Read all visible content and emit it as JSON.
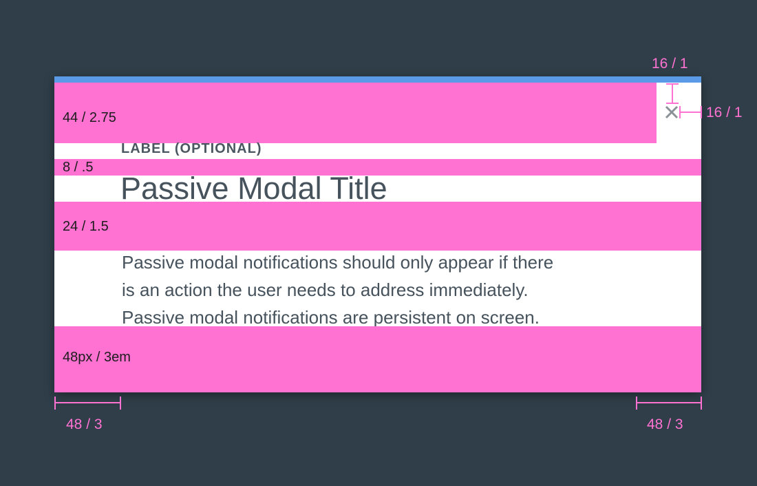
{
  "modal": {
    "label": "LABEL (OPTIONAL)",
    "title": "Passive Modal Title",
    "body_lines": [
      "Passive modal notifications should only appear if there",
      "is an action the user needs to address immediately.",
      "Passive modal notifications are persistent on screen."
    ],
    "close_icon": "close-icon"
  },
  "spacers": {
    "header": "44 / 2.75",
    "label_title": "8 / .5",
    "title_body": "24 / 1.5",
    "footer": "48px / 3em"
  },
  "redlines": {
    "close_top": "16 / 1",
    "close_right": "16 / 1",
    "left_padding": "48 / 3",
    "right_padding": "48 / 3"
  },
  "colors": {
    "background": "#2f3e48",
    "modal": "#ffffff",
    "accent": "#5a9ae6",
    "spacer": "#ff72d2",
    "text": "#46525c"
  }
}
